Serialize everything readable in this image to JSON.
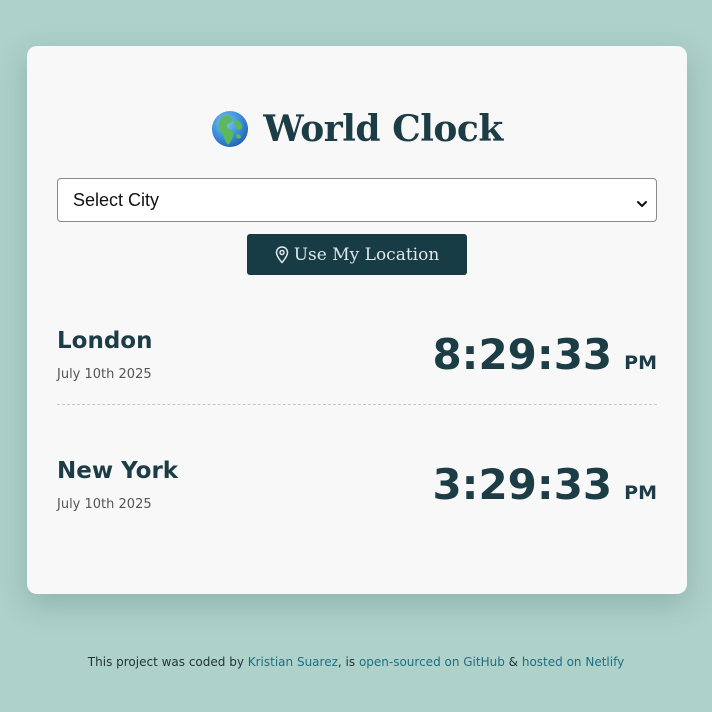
{
  "header": {
    "icon": "globe-europe-africa-icon",
    "title": "World Clock"
  },
  "city_select": {
    "selected": "Select City"
  },
  "location_button": {
    "icon": "map-pin-icon",
    "label": "Use My Location"
  },
  "cities": [
    {
      "name": "London",
      "date": "July 10th 2025",
      "time": "8:29:33",
      "ampm": "PM"
    },
    {
      "name": "New York",
      "date": "July 10th 2025",
      "time": "3:29:33",
      "ampm": "PM"
    }
  ],
  "footer": {
    "prefix": "This project was coded by",
    "author": "Kristian Suarez",
    "mid": ", is",
    "github_link": "open-sourced on GitHub",
    "amp": "&",
    "netlify_link": "hosted on Netlify"
  },
  "colors": {
    "background": "#aed1ca",
    "card": "#f8f8f8",
    "primary": "#1c3d45",
    "button": "#173c45",
    "link": "#1f6f84"
  }
}
